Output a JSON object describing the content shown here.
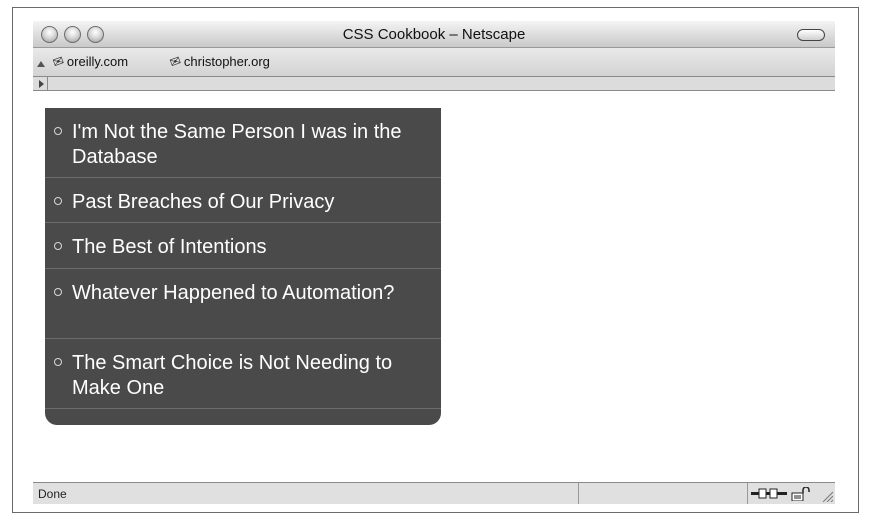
{
  "window": {
    "title": "CSS Cookbook – Netscape"
  },
  "bookmarks": [
    {
      "label": "oreilly.com",
      "icon": "bookmark-icon"
    },
    {
      "label": "christopher.org",
      "icon": "bookmark-icon"
    }
  ],
  "menu": {
    "items": [
      {
        "label": "I'm Not the Same Person I was in the Database"
      },
      {
        "label": "Past Breaches of Our Privacy"
      },
      {
        "label": "The Best of Intentions"
      },
      {
        "label": "Whatever Happened to Automation?"
      },
      {
        "label": "The Smart Choice is Not Needing to Make One"
      }
    ],
    "background_color": "#4a4a4a",
    "text_color": "#ffffff"
  },
  "status": {
    "text": "Done",
    "icons": [
      "connection-plug-icon",
      "security-lock-icon",
      "resize-grip-icon"
    ]
  }
}
